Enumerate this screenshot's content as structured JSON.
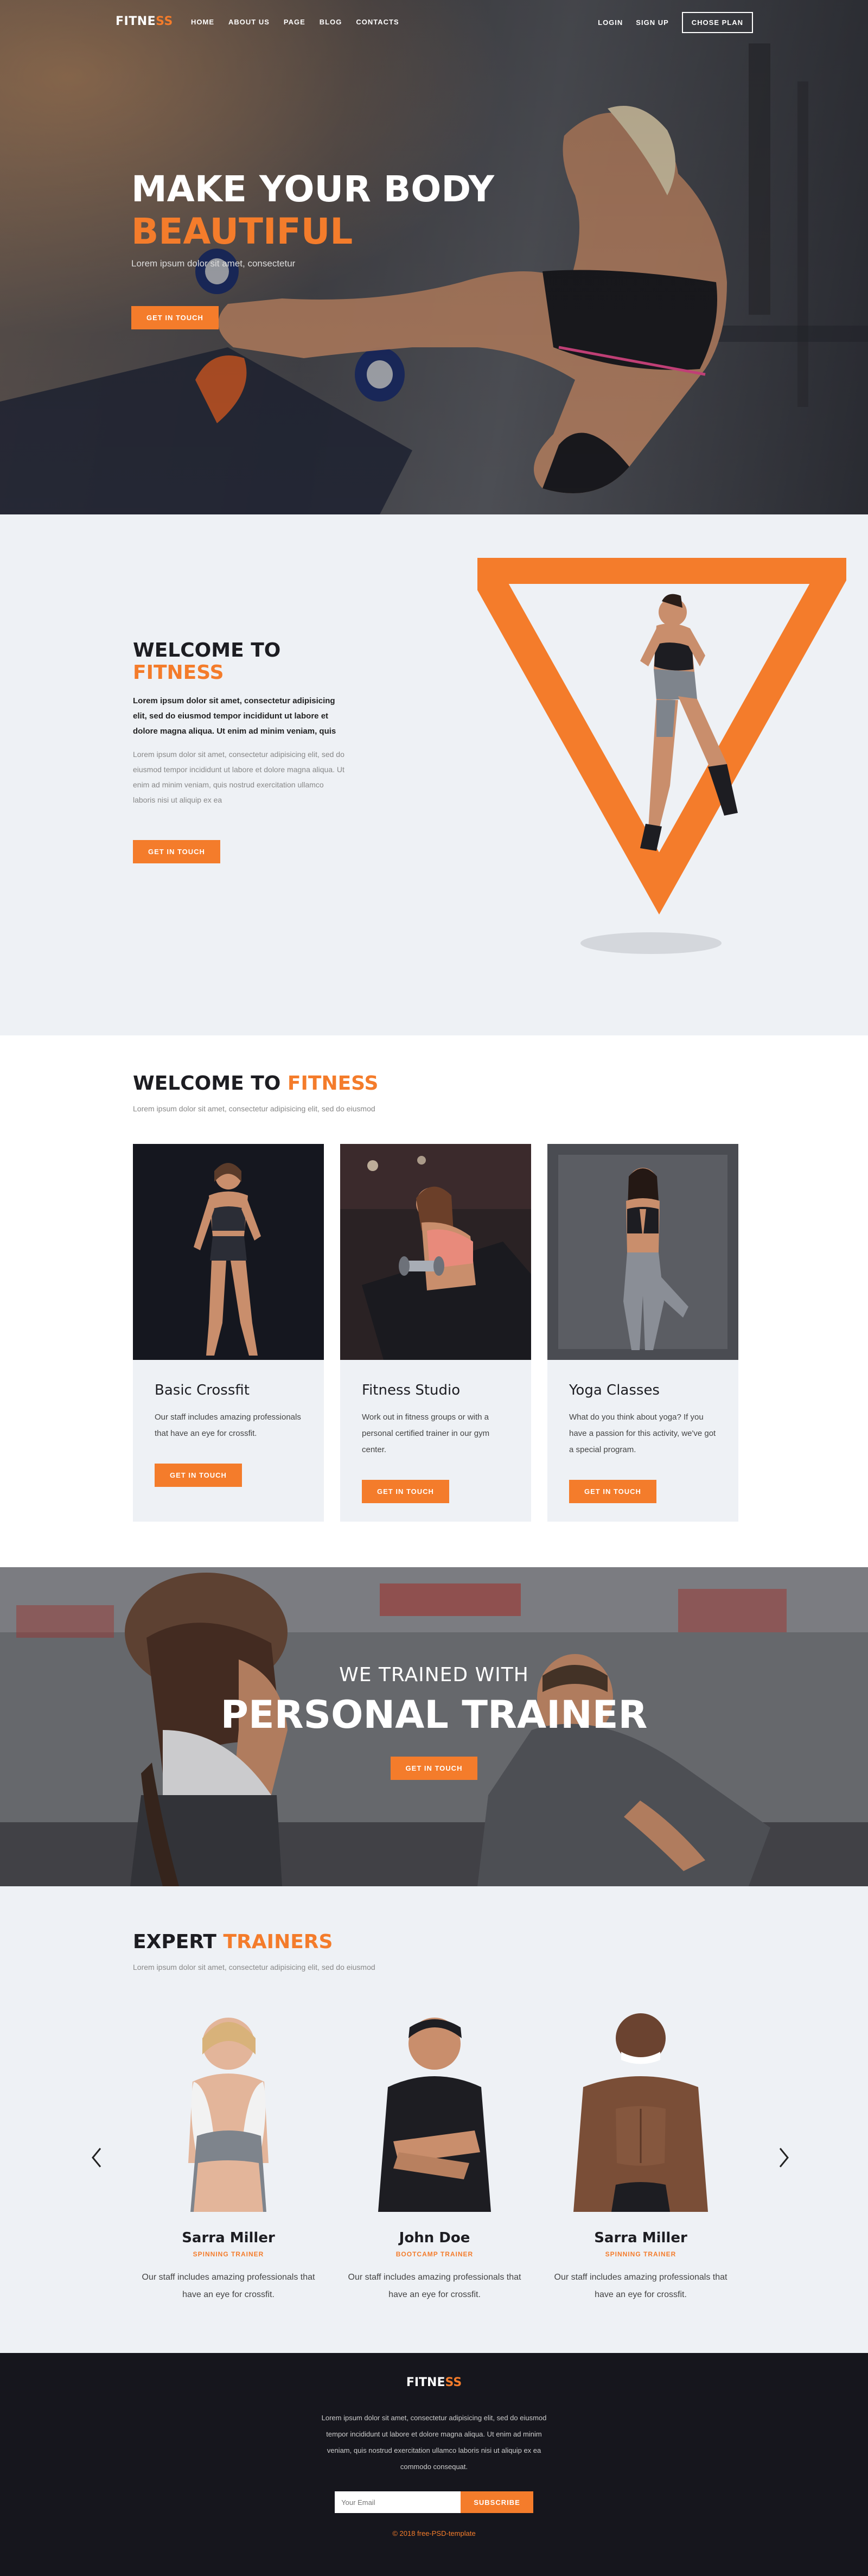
{
  "nav": {
    "logo_part1": "FITNE",
    "logo_part2": "SS",
    "links": [
      "HOME",
      "ABOUT US",
      "PAGE",
      "BLOG",
      "CONTACTS"
    ],
    "login": "LOGIN",
    "signup": "SIGN UP",
    "plan": "CHOSE PLAN"
  },
  "hero": {
    "title_line1": "MAKE YOUR BODY",
    "title_line2": "BEAUTIFUL",
    "subtitle": "Lorem ipsum dolor sit amet, consectetur",
    "button": "GET IN TOUCH"
  },
  "welcome": {
    "title_part1": "WELCOME TO ",
    "title_part2": "FITNESS",
    "bold_text": "Lorem ipsum dolor sit amet, consectetur adipisicing elit, sed do eiusmod tempor incididunt ut labore et dolore magna aliqua. Ut enim ad minim veniam, quis",
    "light_text": "Lorem ipsum dolor sit amet, consectetur adipisicing elit, sed do eiusmod tempor incididunt ut labore et dolore magna aliqua. Ut enim ad minim veniam, quis nostrud exercitation ullamco laboris nisi ut aliquip ex ea",
    "button": "GET IN TOUCH"
  },
  "services": {
    "title_part1": "WELCOME TO ",
    "title_part2": "FITNESS",
    "subtitle": "Lorem ipsum dolor sit amet, consectetur adipisicing elit, sed do eiusmod",
    "cards": [
      {
        "title": "Basic Crossfit",
        "desc": "Our staff includes amazing professionals that have an eye for crossfit.",
        "button": "GET IN TOUCH"
      },
      {
        "title": "Fitness Studio",
        "desc": "Work out in fitness groups or with a personal certified trainer in our gym center.",
        "button": "GET IN TOUCH"
      },
      {
        "title": "Yoga Classes",
        "desc": "What do you think about yoga? If you have a passion for this activity, we've got a special program.",
        "button": "GET IN TOUCH"
      }
    ]
  },
  "banner": {
    "small": "WE TRAINED WITH",
    "big": "PERSONAL TRAINER",
    "button": "GET IN TOUCH"
  },
  "experts": {
    "title_part1": "EXPERT ",
    "title_part2": "TRAINERS",
    "subtitle": "Lorem ipsum dolor sit amet, consectetur adipisicing elit, sed do eiusmod",
    "trainers": [
      {
        "name": "Sarra Miller",
        "role": "SPINNING TRAINER",
        "desc": "Our staff includes amazing professionals that have an eye for crossfit."
      },
      {
        "name": "John Doe",
        "role": "BOOTCAMP TRAINER",
        "desc": "Our staff includes amazing professionals that have an eye for crossfit."
      },
      {
        "name": "Sarra Miller",
        "role": "SPINNING TRAINER",
        "desc": "Our staff includes amazing professionals that have an eye for crossfit."
      }
    ]
  },
  "footer": {
    "logo_part1": "FITNE",
    "logo_part2": "SS",
    "text": "Lorem ipsum dolor sit amet, consectetur adipisicing elit, sed do eiusmod tempor incididunt ut labore et dolore magna aliqua. Ut enim ad minim veniam, quis nostrud exercitation ullamco laboris nisi ut aliquip ex ea commodo consequat.",
    "email_placeholder": "Your Email",
    "subscribe": "SUBSCRIBE",
    "copyright": "© 2018 free-PSD-template"
  },
  "colors": {
    "accent": "#f47c2b",
    "dark": "#16161d",
    "light_bg": "#eef1f5"
  }
}
